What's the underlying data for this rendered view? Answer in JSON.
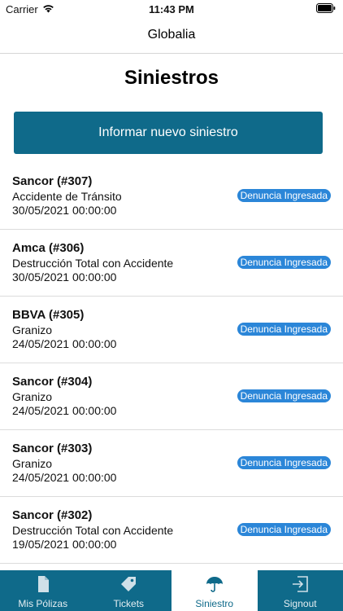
{
  "status_bar": {
    "carrier": "Carrier",
    "time": "11:43 PM"
  },
  "nav": {
    "title": "Globalia"
  },
  "page": {
    "title": "Siniestros"
  },
  "actions": {
    "new_claim_label": "Informar nuevo siniestro"
  },
  "claims": [
    {
      "title": "Sancor (#307)",
      "type": "Accidente de Tránsito",
      "date": "30/05/2021 00:00:00",
      "status": "Denuncia Ingresada"
    },
    {
      "title": "Amca (#306)",
      "type": "Destrucción Total con Accidente",
      "date": "30/05/2021 00:00:00",
      "status": "Denuncia Ingresada"
    },
    {
      "title": "BBVA (#305)",
      "type": "Granizo",
      "date": "24/05/2021 00:00:00",
      "status": "Denuncia Ingresada"
    },
    {
      "title": "Sancor (#304)",
      "type": "Granizo",
      "date": "24/05/2021 00:00:00",
      "status": "Denuncia Ingresada"
    },
    {
      "title": "Sancor (#303)",
      "type": "Granizo",
      "date": "24/05/2021 00:00:00",
      "status": "Denuncia Ingresada"
    },
    {
      "title": "Sancor (#302)",
      "type": "Destrucción Total con Accidente",
      "date": "19/05/2021 00:00:00",
      "status": "Denuncia Ingresada"
    }
  ],
  "tabs": [
    {
      "label": "Mis Pólizas",
      "icon": "document-icon",
      "active": false
    },
    {
      "label": "Tickets",
      "icon": "tag-icon",
      "active": false
    },
    {
      "label": "Siniestro",
      "icon": "umbrella-icon",
      "active": true
    },
    {
      "label": "Signout",
      "icon": "signout-icon",
      "active": false
    }
  ],
  "colors": {
    "brand": "#0f6a8a",
    "badge": "#2b86d8"
  }
}
